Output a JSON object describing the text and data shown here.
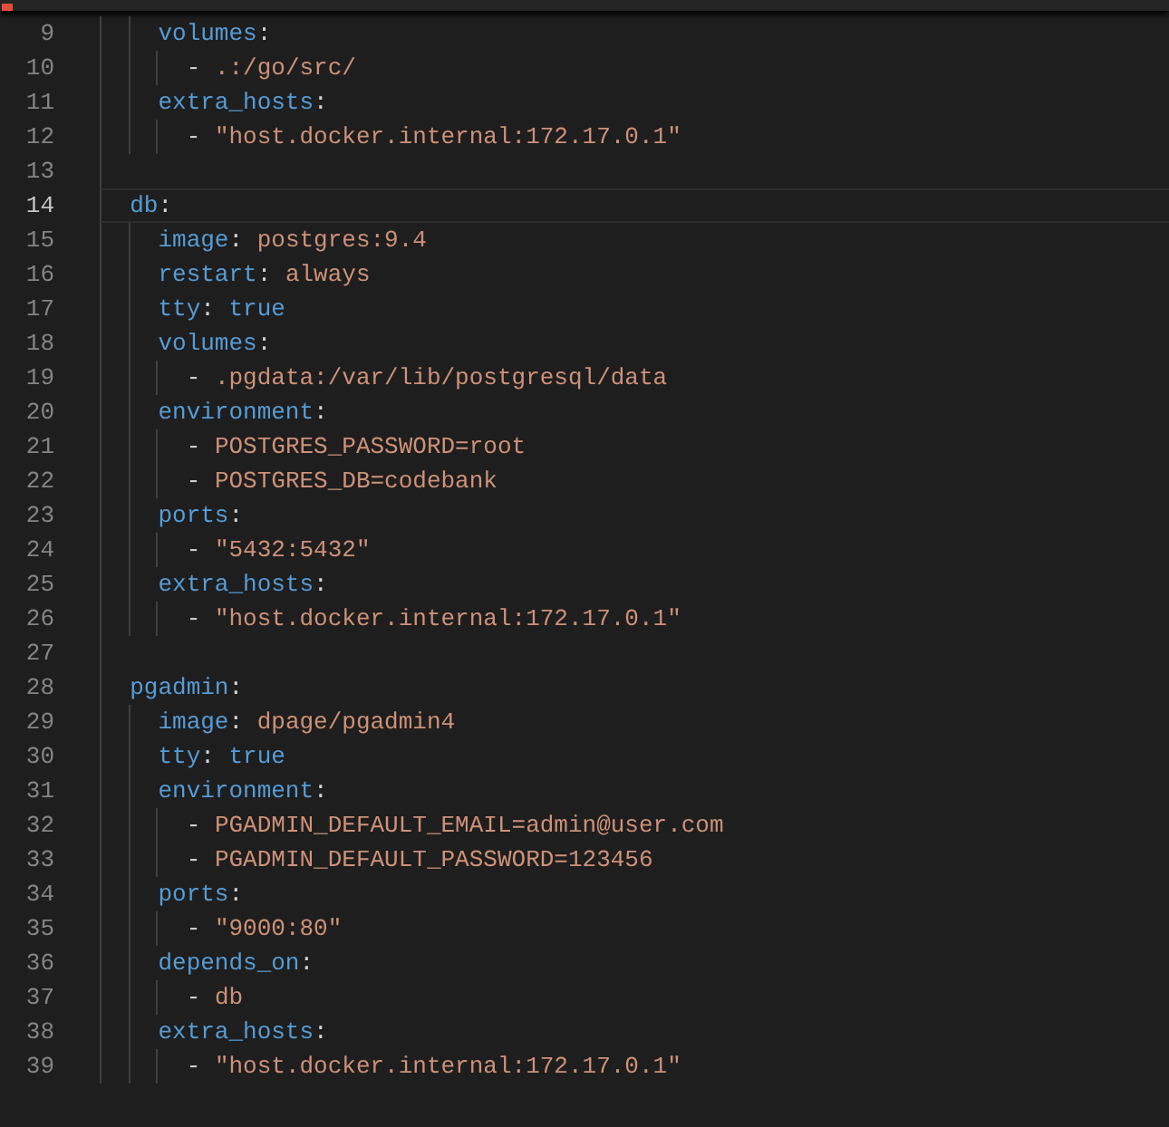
{
  "editor": {
    "lines": [
      {
        "number": "9",
        "selected": false,
        "segments": [
          {
            "kind": "key",
            "text": "    volumes"
          },
          {
            "kind": "punct",
            "text": ":"
          }
        ]
      },
      {
        "number": "10",
        "selected": false,
        "segments": [
          {
            "kind": "punct",
            "text": "      - "
          },
          {
            "kind": "string",
            "text": ".:/go/src/"
          }
        ]
      },
      {
        "number": "11",
        "selected": false,
        "segments": [
          {
            "kind": "key",
            "text": "    extra_hosts"
          },
          {
            "kind": "punct",
            "text": ":"
          }
        ]
      },
      {
        "number": "12",
        "selected": false,
        "segments": [
          {
            "kind": "punct",
            "text": "      - "
          },
          {
            "kind": "string",
            "text": "\"host.docker.internal:172.17.0.1\""
          }
        ]
      },
      {
        "number": "13",
        "selected": false
      },
      {
        "number": "14",
        "selected": true,
        "segments": [
          {
            "kind": "key",
            "text": "  db"
          },
          {
            "kind": "punct",
            "text": ":"
          }
        ]
      },
      {
        "number": "15",
        "selected": false,
        "segments": [
          {
            "kind": "key",
            "text": "    image"
          },
          {
            "kind": "punct",
            "text": ": "
          },
          {
            "kind": "string",
            "text": "postgres:9.4"
          }
        ]
      },
      {
        "number": "16",
        "selected": false,
        "segments": [
          {
            "kind": "key",
            "text": "    restart"
          },
          {
            "kind": "punct",
            "text": ": "
          },
          {
            "kind": "string",
            "text": "always"
          }
        ]
      },
      {
        "number": "17",
        "selected": false,
        "segments": [
          {
            "kind": "key",
            "text": "    tty"
          },
          {
            "kind": "punct",
            "text": ": "
          },
          {
            "kind": "bool",
            "text": "true"
          }
        ]
      },
      {
        "number": "18",
        "selected": false,
        "segments": [
          {
            "kind": "key",
            "text": "    volumes"
          },
          {
            "kind": "punct",
            "text": ":"
          }
        ]
      },
      {
        "number": "19",
        "selected": false,
        "segments": [
          {
            "kind": "punct",
            "text": "      - "
          },
          {
            "kind": "string",
            "text": ".pgdata:/var/lib/postgresql/data"
          }
        ]
      },
      {
        "number": "20",
        "selected": false,
        "segments": [
          {
            "kind": "key",
            "text": "    environment"
          },
          {
            "kind": "punct",
            "text": ":"
          }
        ]
      },
      {
        "number": "21",
        "selected": false,
        "segments": [
          {
            "kind": "punct",
            "text": "      - "
          },
          {
            "kind": "string",
            "text": "POSTGRES_PASSWORD=root"
          }
        ]
      },
      {
        "number": "22",
        "selected": false,
        "segments": [
          {
            "kind": "punct",
            "text": "      - "
          },
          {
            "kind": "string",
            "text": "POSTGRES_DB=codebank"
          }
        ]
      },
      {
        "number": "23",
        "selected": false,
        "segments": [
          {
            "kind": "key",
            "text": "    ports"
          },
          {
            "kind": "punct",
            "text": ":"
          }
        ]
      },
      {
        "number": "24",
        "selected": false,
        "segments": [
          {
            "kind": "punct",
            "text": "      - "
          },
          {
            "kind": "string",
            "text": "\"5432:5432\""
          }
        ]
      },
      {
        "number": "25",
        "selected": false,
        "segments": [
          {
            "kind": "key",
            "text": "    extra_hosts"
          },
          {
            "kind": "punct",
            "text": ":"
          }
        ]
      },
      {
        "number": "26",
        "selected": false,
        "segments": [
          {
            "kind": "punct",
            "text": "      - "
          },
          {
            "kind": "string",
            "text": "\"host.docker.internal:172.17.0.1\""
          }
        ]
      },
      {
        "number": "27",
        "selected": false
      },
      {
        "number": "28",
        "selected": false,
        "segments": [
          {
            "kind": "key",
            "text": "  pgadmin"
          },
          {
            "kind": "punct",
            "text": ":"
          }
        ]
      },
      {
        "number": "29",
        "selected": false,
        "segments": [
          {
            "kind": "key",
            "text": "    image"
          },
          {
            "kind": "punct",
            "text": ": "
          },
          {
            "kind": "string",
            "text": "dpage/pgadmin4"
          }
        ]
      },
      {
        "number": "30",
        "selected": false,
        "segments": [
          {
            "kind": "key",
            "text": "    tty"
          },
          {
            "kind": "punct",
            "text": ": "
          },
          {
            "kind": "bool",
            "text": "true"
          }
        ]
      },
      {
        "number": "31",
        "selected": false,
        "segments": [
          {
            "kind": "key",
            "text": "    environment"
          },
          {
            "kind": "punct",
            "text": ":"
          }
        ]
      },
      {
        "number": "32",
        "selected": false,
        "segments": [
          {
            "kind": "punct",
            "text": "      - "
          },
          {
            "kind": "string",
            "text": "PGADMIN_DEFAULT_EMAIL=admin@user.com"
          }
        ]
      },
      {
        "number": "33",
        "selected": false,
        "segments": [
          {
            "kind": "punct",
            "text": "      - "
          },
          {
            "kind": "string",
            "text": "PGADMIN_DEFAULT_PASSWORD=123456"
          }
        ]
      },
      {
        "number": "34",
        "selected": false,
        "segments": [
          {
            "kind": "key",
            "text": "    ports"
          },
          {
            "kind": "punct",
            "text": ":"
          }
        ]
      },
      {
        "number": "35",
        "selected": false,
        "segments": [
          {
            "kind": "punct",
            "text": "      - "
          },
          {
            "kind": "string",
            "text": "\"9000:80\""
          }
        ]
      },
      {
        "number": "36",
        "selected": false,
        "segments": [
          {
            "kind": "key",
            "text": "    depends_on"
          },
          {
            "kind": "punct",
            "text": ":"
          }
        ]
      },
      {
        "number": "37",
        "selected": false,
        "segments": [
          {
            "kind": "punct",
            "text": "      - "
          },
          {
            "kind": "string",
            "text": "db"
          }
        ]
      },
      {
        "number": "38",
        "selected": false,
        "segments": [
          {
            "kind": "key",
            "text": "    extra_hosts"
          },
          {
            "kind": "punct",
            "text": ":"
          }
        ]
      },
      {
        "number": "39",
        "selected": false,
        "segments": [
          {
            "kind": "punct",
            "text": "      - "
          },
          {
            "kind": "string",
            "text": "\"host.docker.internal:172.17.0.1\""
          }
        ]
      }
    ]
  }
}
